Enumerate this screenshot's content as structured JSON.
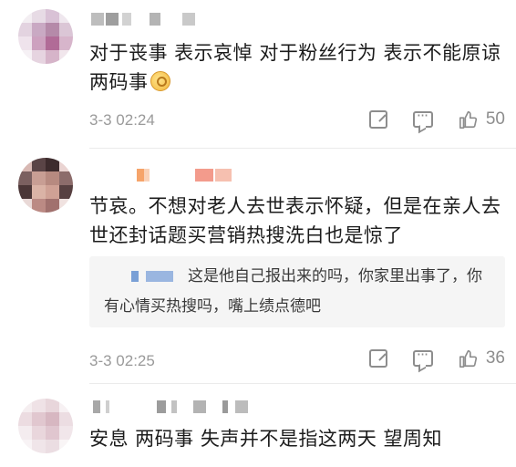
{
  "comments": [
    {
      "text": "对于丧事 表示哀悼 对于粉丝行为 表示不能原谅 两码事",
      "emoji": "ok-hand-emoji",
      "time": "3-3 02:24",
      "likes": "50"
    },
    {
      "text": "节哀。不想对老人去世表示怀疑，但是在亲人去世还封话题买营销热搜洗白也是惊了",
      "reply": "这是他自己报出来的吗，你家里出事了，你有心情买热搜吗，嘴上绩点德吧",
      "time": "3-3 02:25",
      "likes": "36"
    },
    {
      "text": "安息 两码事 失声并不是指这两天 望周知"
    }
  ],
  "icons": {
    "forward": "share-square-icon",
    "comment": "comment-bubble-icon",
    "like": "thumbs-up-icon"
  },
  "colors": {
    "meta_gray": "#9a9a9a",
    "icon_gray": "#8d8d8d",
    "reply_bg": "#f5f5f5"
  }
}
